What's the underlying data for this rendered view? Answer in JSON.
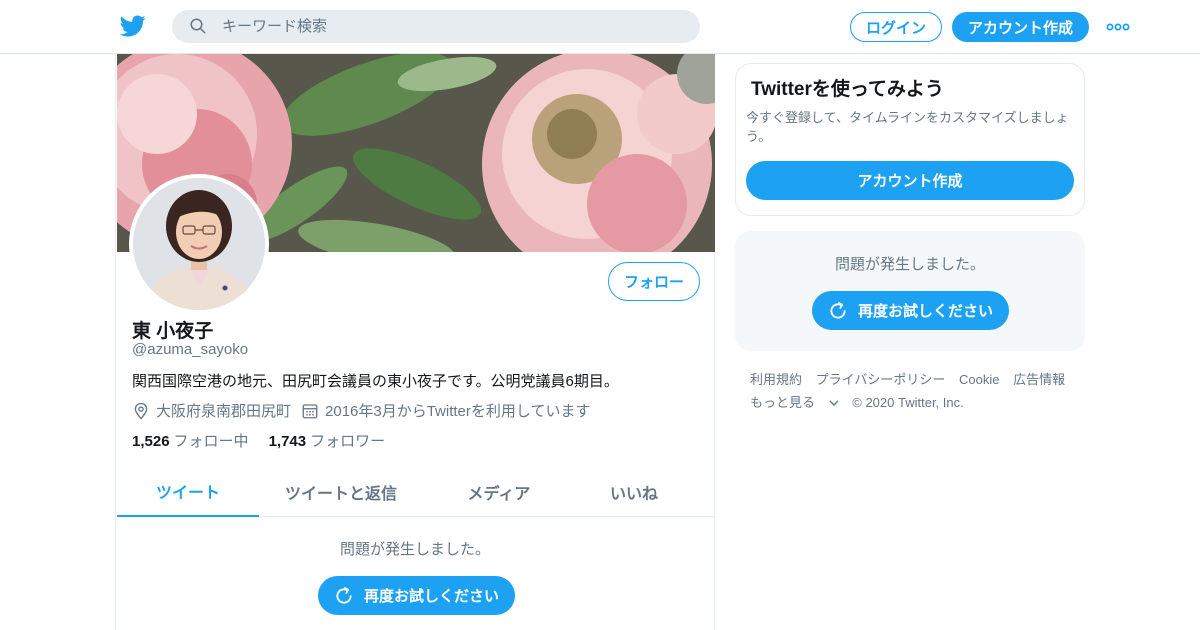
{
  "header": {
    "logo_icon": "twitter-bird-icon",
    "search_placeholder": "キーワード検索",
    "login_label": "ログイン",
    "signup_label": "アカウント作成",
    "more_icon": "more-dots-icon",
    "accent_color": "#1da1f2"
  },
  "profile": {
    "follow_label": "フォロー",
    "name": "東 小夜子",
    "handle": "@azuma_sayoko",
    "bio": "関西国際空港の地元、田尻町会議員の東小夜子です。公明党議員6期目。",
    "location": "大阪府泉南郡田尻町",
    "joined": "2016年3月からTwitterを利用しています",
    "following_count": "1,526",
    "following_label": "フォロー中",
    "followers_count": "1,743",
    "followers_label": "フォロワー"
  },
  "tabs": [
    {
      "label": "ツイート",
      "active": true
    },
    {
      "label": "ツイートと返信",
      "active": false
    },
    {
      "label": "メディア",
      "active": false
    },
    {
      "label": "いいね",
      "active": false
    }
  ],
  "timeline": {
    "error_text": "問題が発生しました。",
    "retry_label": "再度お試しください"
  },
  "sidebar": {
    "signup_card": {
      "title": "Twitterを使ってみよう",
      "description": "今すぐ登録して、タイムラインをカスタマイズしましょう。",
      "button_label": "アカウント作成"
    },
    "error_card": {
      "error_text": "問題が発生しました。",
      "retry_label": "再度お試しください"
    },
    "footer": {
      "links": [
        "利用規約",
        "プライバシーポリシー",
        "Cookie",
        "広告情報"
      ],
      "more_label": "もっと見る",
      "copyright": "© 2020 Twitter, Inc."
    }
  }
}
